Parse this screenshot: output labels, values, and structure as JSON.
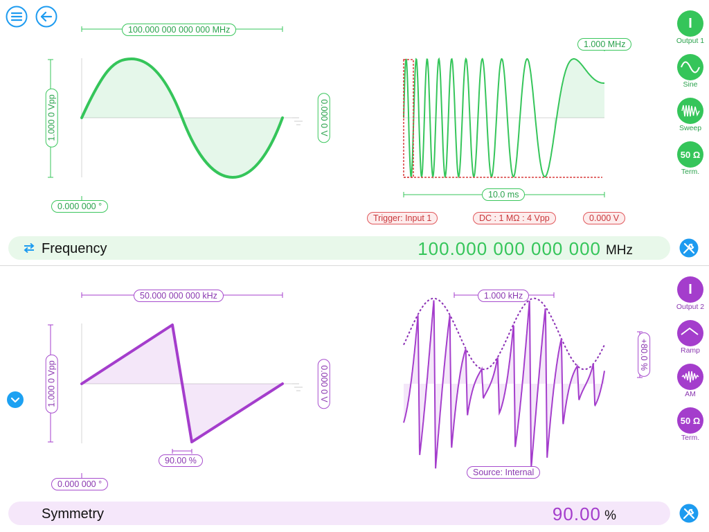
{
  "colors": {
    "green": "#35c55a",
    "purple": "#a43dcc",
    "blue": "#1d9bf0",
    "red": "#e0575b"
  },
  "top": {
    "period_label": "100.000 000 000 000 MHz",
    "amplitude_label": "1.000 0 Vpp",
    "offset_label": "0.000 0 V",
    "phase_label": "0.000 000 °",
    "mod_freq_label": "1.000 MHz",
    "time_label": "10.0 ms",
    "trigger_label": "Trigger: Input 1",
    "coupling_label": "DC : 1 MΩ : 4 Vpp",
    "trigger_level_label": "0.000 V",
    "param_label": "Frequency",
    "param_value": "100.000 000 000 000",
    "param_unit": "MHz"
  },
  "bottom": {
    "period_label": "50.000 000 000 kHz",
    "amplitude_label": "1.000 0 Vpp",
    "offset_label": "0.000 0 V",
    "phase_label": "0.000 000 °",
    "symmetry_marker_label": "90.00 %",
    "mod_freq_label": "1.000 kHz",
    "depth_label": "+80.0 %",
    "source_label": "Source: Internal",
    "param_label": "Symmetry",
    "param_value": "90.00",
    "param_unit": "%"
  },
  "sidebar_top": [
    {
      "label": "Output 1",
      "glyph": "I"
    },
    {
      "label": "Sine",
      "glyph": ""
    },
    {
      "label": "Sweep",
      "glyph": ""
    },
    {
      "label": "Term.",
      "glyph": "50 Ω"
    }
  ],
  "sidebar_bottom": [
    {
      "label": "Output 2",
      "glyph": "I"
    },
    {
      "label": "Ramp",
      "glyph": ""
    },
    {
      "label": "AM",
      "glyph": ""
    },
    {
      "label": "Term.",
      "glyph": "50 Ω"
    }
  ]
}
